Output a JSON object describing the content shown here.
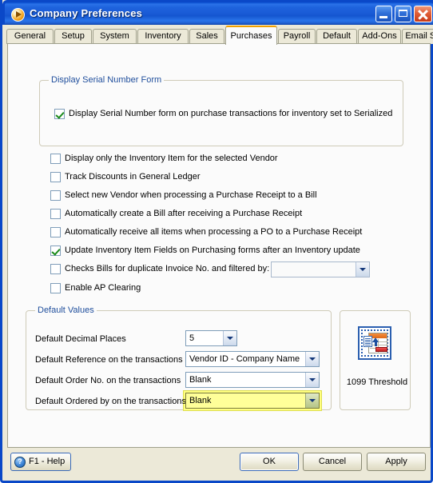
{
  "window": {
    "title": "Company Preferences",
    "icon": "play-circle-icon",
    "controls": {
      "minimize": "minimize-icon",
      "maximize": "maximize-icon",
      "close": "close-icon"
    }
  },
  "tabs": [
    {
      "label": "General",
      "active": false
    },
    {
      "label": "Setup",
      "active": false
    },
    {
      "label": "System",
      "active": false
    },
    {
      "label": "Inventory",
      "active": false
    },
    {
      "label": "Sales",
      "active": false
    },
    {
      "label": "Purchases",
      "active": true
    },
    {
      "label": "Payroll",
      "active": false
    },
    {
      "label": "Default",
      "active": false
    },
    {
      "label": "Add-Ons",
      "active": false
    },
    {
      "label": "Email Setup",
      "active": false
    }
  ],
  "serial_group": {
    "title": "Display Serial Number Form",
    "checkbox": {
      "label": "Display Serial Number form on purchase transactions for inventory set to Serialized",
      "checked": true
    }
  },
  "options": [
    {
      "label": "Display only the Inventory Item for the selected Vendor",
      "checked": false
    },
    {
      "label": "Track Discounts in General Ledger",
      "checked": false
    },
    {
      "label": "Select new Vendor when processing a Purchase Receipt to a Bill",
      "checked": false
    },
    {
      "label": "Automatically create a Bill after receiving a Purchase Receipt",
      "checked": false
    },
    {
      "label": "Automatically receive all items when processing a PO to a Purchase Receipt",
      "checked": false
    },
    {
      "label": "Update Inventory Item Fields on Purchasing forms after an Inventory update",
      "checked": true
    },
    {
      "label": "Checks Bills for duplicate Invoice No. and filtered by:",
      "checked": false
    },
    {
      "label": "Enable AP Clearing",
      "checked": false
    }
  ],
  "duplicate_filter_combo": {
    "value": "",
    "disabled": true
  },
  "default_values": {
    "title": "Default Values",
    "rows": [
      {
        "label": "Default Decimal Places",
        "value": "5",
        "focused": false
      },
      {
        "label": "Default Reference on the transactions",
        "value": "Vendor ID - Company Name",
        "focused": false
      },
      {
        "label": "Default Order No. on the transactions",
        "value": "Blank",
        "focused": false
      },
      {
        "label": "Default Ordered by on the transactions",
        "value": "Blank",
        "focused": true
      }
    ]
  },
  "threshold_panel": {
    "icon": "spreadsheet-import-icon",
    "label": "1099 Threshold"
  },
  "footer": {
    "help": "F1 - Help",
    "help_icon": "question-circle-icon",
    "ok": "OK",
    "cancel": "Cancel",
    "apply": "Apply"
  },
  "colors": {
    "title_bar": "#1a5bd6",
    "window_border": "#0a48c8",
    "active_tab_accent": "#f0a000",
    "group_label": "#1f4e9c",
    "check_green": "#1a8a1a",
    "focus_yellow": "#ffff99",
    "panel": "#fbfbfb",
    "dialog_face": "#ece9d8"
  }
}
